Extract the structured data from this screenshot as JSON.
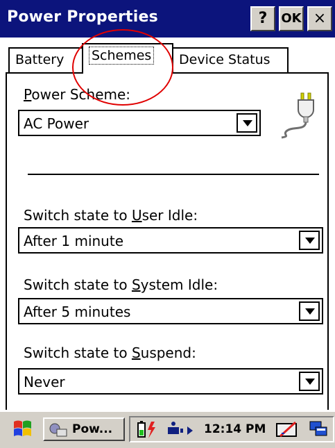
{
  "window": {
    "title": "Power Properties",
    "help_label": "?",
    "ok_label": "OK",
    "close_label": "×"
  },
  "tabs": [
    {
      "label": "Battery",
      "active": false
    },
    {
      "label": "Schemes",
      "active": true
    },
    {
      "label": "Device Status",
      "active": false
    }
  ],
  "schemes": {
    "power_scheme": {
      "label_accel": "P",
      "label_rest": "ower Scheme:",
      "value": "AC Power"
    },
    "user_idle": {
      "label_pre": "Switch state to ",
      "label_accel": "U",
      "label_rest": "ser Idle:",
      "value": "After 1 minute"
    },
    "system_idle": {
      "label_pre": "Switch state to ",
      "label_accel": "S",
      "label_rest": "ystem Idle:",
      "value": "After 5 minutes"
    },
    "suspend": {
      "label_pre": "Switch state to ",
      "label_accel": "S",
      "label_rest": "uspend:",
      "value": "Never"
    }
  },
  "taskbar": {
    "task_label": "Pow...",
    "clock": "12:14 PM"
  },
  "icons": [
    "plug-icon",
    "windows-flag-icon",
    "app-icon",
    "battery-icon",
    "connectivity-icon",
    "keyboard-icon",
    "windows-switch-icon"
  ],
  "colors": {
    "titlebar": "#0c147c",
    "annotation": "#e00000",
    "chrome": "#d4d0c8"
  }
}
